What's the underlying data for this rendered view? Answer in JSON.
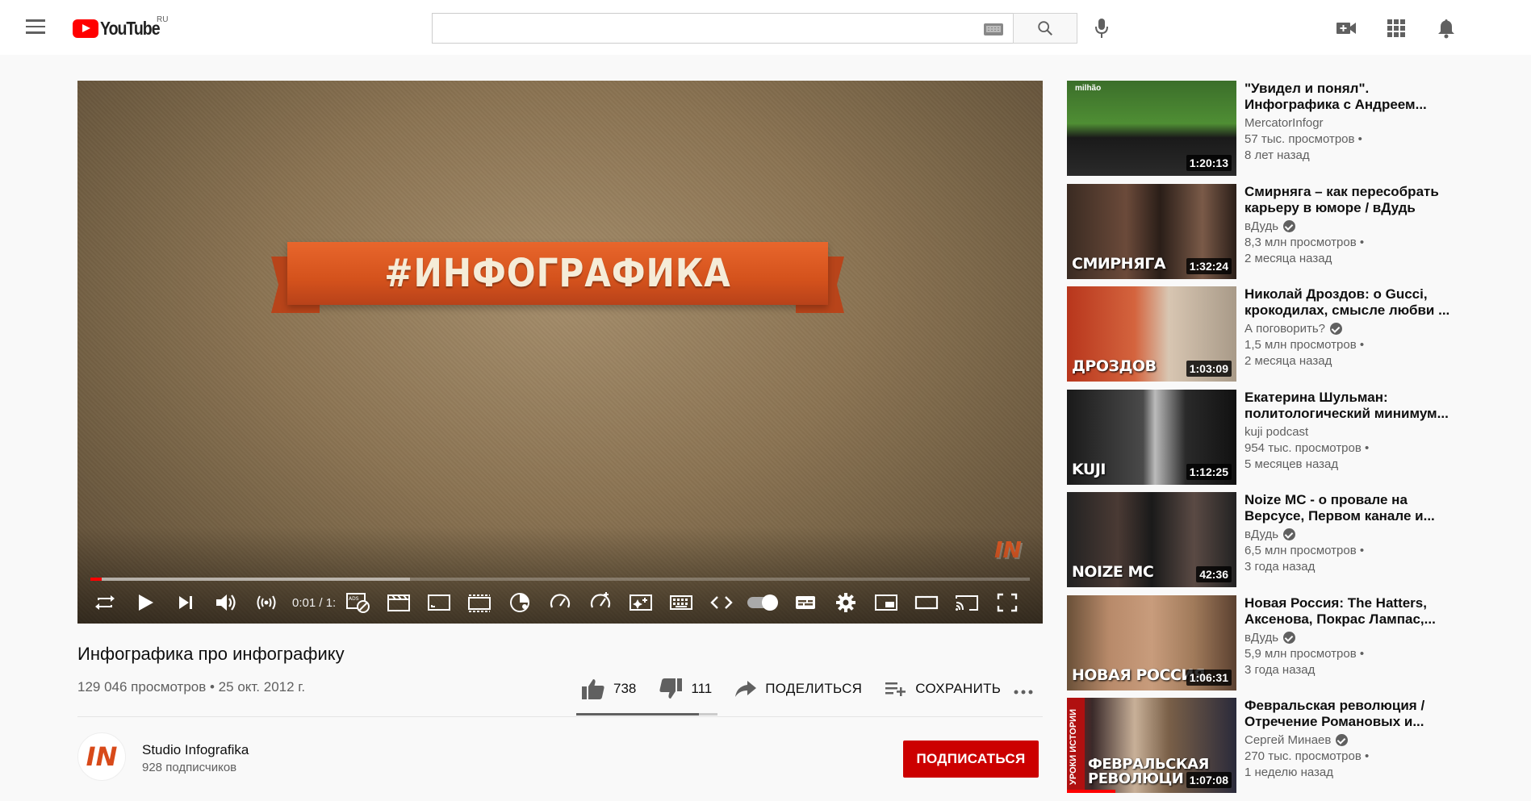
{
  "header": {
    "logo_text": "YouTube",
    "region": "RU",
    "search_placeholder": ""
  },
  "player": {
    "banner_text": "#ИНФОГРАФИКА",
    "time": "0:01 / 1:",
    "progress_played": 0.012,
    "progress_loaded": 0.34
  },
  "video": {
    "title": "Инфографика про инфографику",
    "meta": "129 046 просмотров • 25 окт. 2012 г.",
    "likes": "738",
    "dislikes": "111",
    "like_ratio": 0.87,
    "share_label": "ПОДЕЛИТЬСЯ",
    "save_label": "СОХРАНИТЬ"
  },
  "channel": {
    "name": "Studio Infografika",
    "subs": "928 подписчиков",
    "avatar_text": "IN",
    "subscribe_label": "ПОДПИСАТЬСЯ"
  },
  "recommendations": [
    {
      "title": "\"Увидел и понял\". Инфографика с Андреем...",
      "channel": "MercatorInfogr",
      "verified": false,
      "views": "57 тыс. просмотров •",
      "age": "8 лет назад",
      "duration": "1:20:13",
      "caption": "",
      "tag": "milhão"
    },
    {
      "title": "Смирняга – как пересобрать карьеру в юморе / вДудь",
      "channel": "вДудь",
      "verified": true,
      "views": "8,3 млн просмотров •",
      "age": "2 месяца назад",
      "duration": "1:32:24",
      "caption": "СМИРНЯГА",
      "tag": ""
    },
    {
      "title": "Николай Дроздов: о Gucci, крокодилах, смысле любви ...",
      "channel": "А поговорить?",
      "verified": true,
      "views": "1,5 млн просмотров •",
      "age": "2 месяца назад",
      "duration": "1:03:09",
      "caption": "ДРОЗДОВ",
      "tag": ""
    },
    {
      "title": "Екатерина Шульман: политологический минимум...",
      "channel": "kuji podcast",
      "verified": false,
      "views": "954 тыс. просмотров •",
      "age": "5 месяцев назад",
      "duration": "1:12:25",
      "caption": "KUJI",
      "tag": ""
    },
    {
      "title": "Noize MC - о провале на Версусе, Первом канале и...",
      "channel": "вДудь",
      "verified": true,
      "views": "6,5 млн просмотров •",
      "age": "3 года назад",
      "duration": "42:36",
      "caption": "NOIZE MC",
      "tag": ""
    },
    {
      "title": "Новая Россия: The Hatters, Аксенова, Покрас Лампас,...",
      "channel": "вДудь",
      "verified": true,
      "views": "5,9 млн просмотров •",
      "age": "3 года назад",
      "duration": "1:06:31",
      "caption": "НОВАЯ РОССИЯ",
      "tag": ""
    },
    {
      "title": "Февральская революция / Отречение Романовых и...",
      "channel": "Сергей Минаев",
      "verified": true,
      "views": "270 тыс. просмотров •",
      "age": "1 неделю назад",
      "duration": "1:07:08",
      "caption": "ФЕВРАЛЬСКАЯ РЕВОЛЮЦИ",
      "tag": "УРОКИ ИСТОРИИ"
    }
  ],
  "colors": {
    "brand_red": "#ff0000",
    "subscribe_red": "#cc0000",
    "ribbon_orange": "#d4521c"
  }
}
